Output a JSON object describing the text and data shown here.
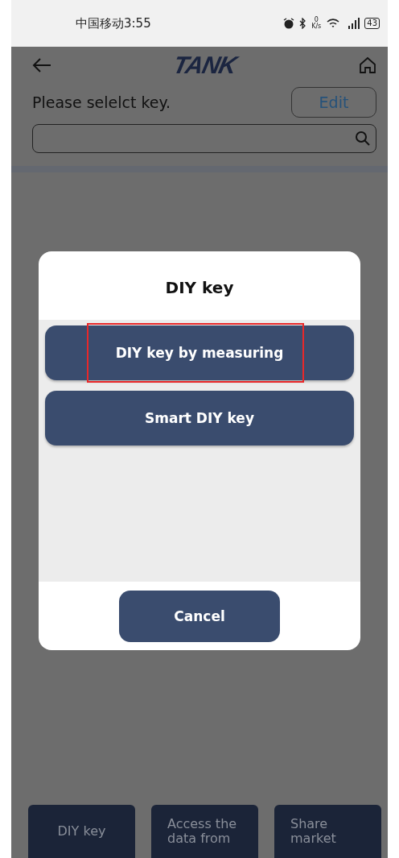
{
  "status_bar": {
    "carrier_time": "中国移动3:55",
    "net_speed": [
      "0",
      "K/s"
    ],
    "battery": "43"
  },
  "header": {
    "logo": "TANK"
  },
  "prompt": "Please selelct key.",
  "edit_button": "Edit",
  "dialog": {
    "title": "DIY key",
    "options": [
      {
        "label": "DIY key by measuring",
        "highlighted": true
      },
      {
        "label": "Smart DIY key",
        "highlighted": false
      }
    ],
    "cancel": "Cancel"
  },
  "bottom_buttons": [
    "DIY key",
    "Access the data from",
    "Share market"
  ]
}
